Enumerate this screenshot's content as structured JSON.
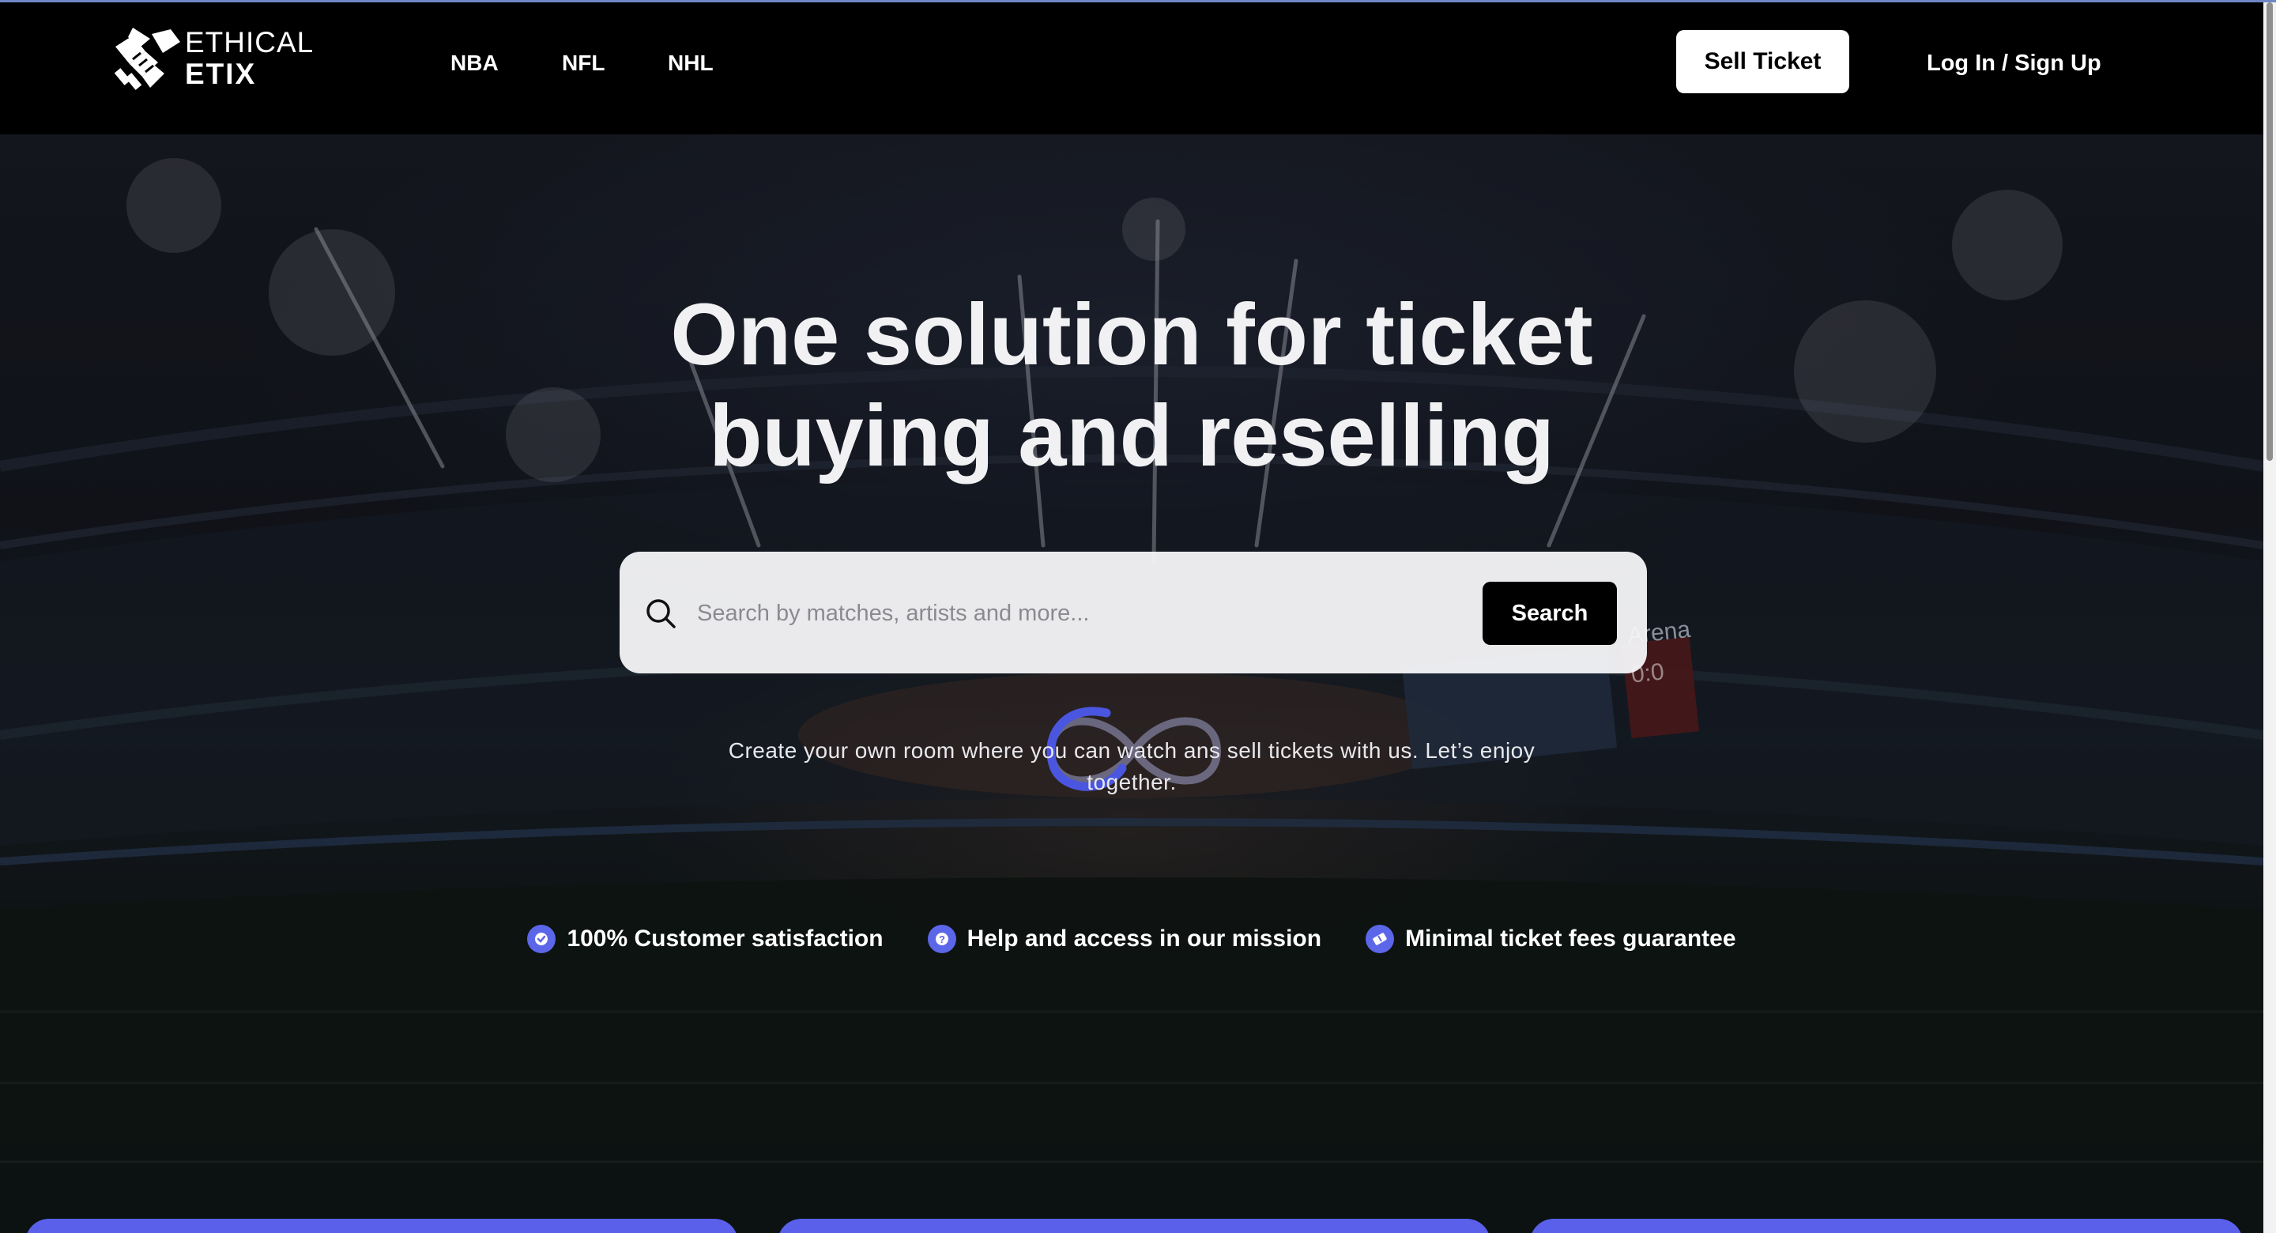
{
  "brand": {
    "line1": "ETHICAL",
    "line2": "ETIX"
  },
  "nav": {
    "items": [
      "NBA",
      "NFL",
      "NHL"
    ]
  },
  "header": {
    "sell_label": "Sell Ticket",
    "login_label": "Log In / Sign Up"
  },
  "hero": {
    "title_line1": "One solution for ticket",
    "title_line2": "buying and reselling",
    "subtitle": "Create your own room where you can watch ans sell tickets with us. Let’s enjoy together."
  },
  "search": {
    "placeholder": "Search by matches, artists and more...",
    "button_label": "Search"
  },
  "features": [
    {
      "label": "100% Customer satisfaction",
      "icon": "check-badge-icon"
    },
    {
      "label": "Help and access in our mission",
      "icon": "question-icon"
    },
    {
      "label": "Minimal ticket fees guarantee",
      "icon": "ticket-icon"
    }
  ],
  "background_text": {
    "arena_sign": "Arena",
    "scoreboard": "0:0"
  },
  "colors": {
    "accent": "#5c66e8",
    "navbar": "#000000",
    "card": "#5a60ea"
  }
}
